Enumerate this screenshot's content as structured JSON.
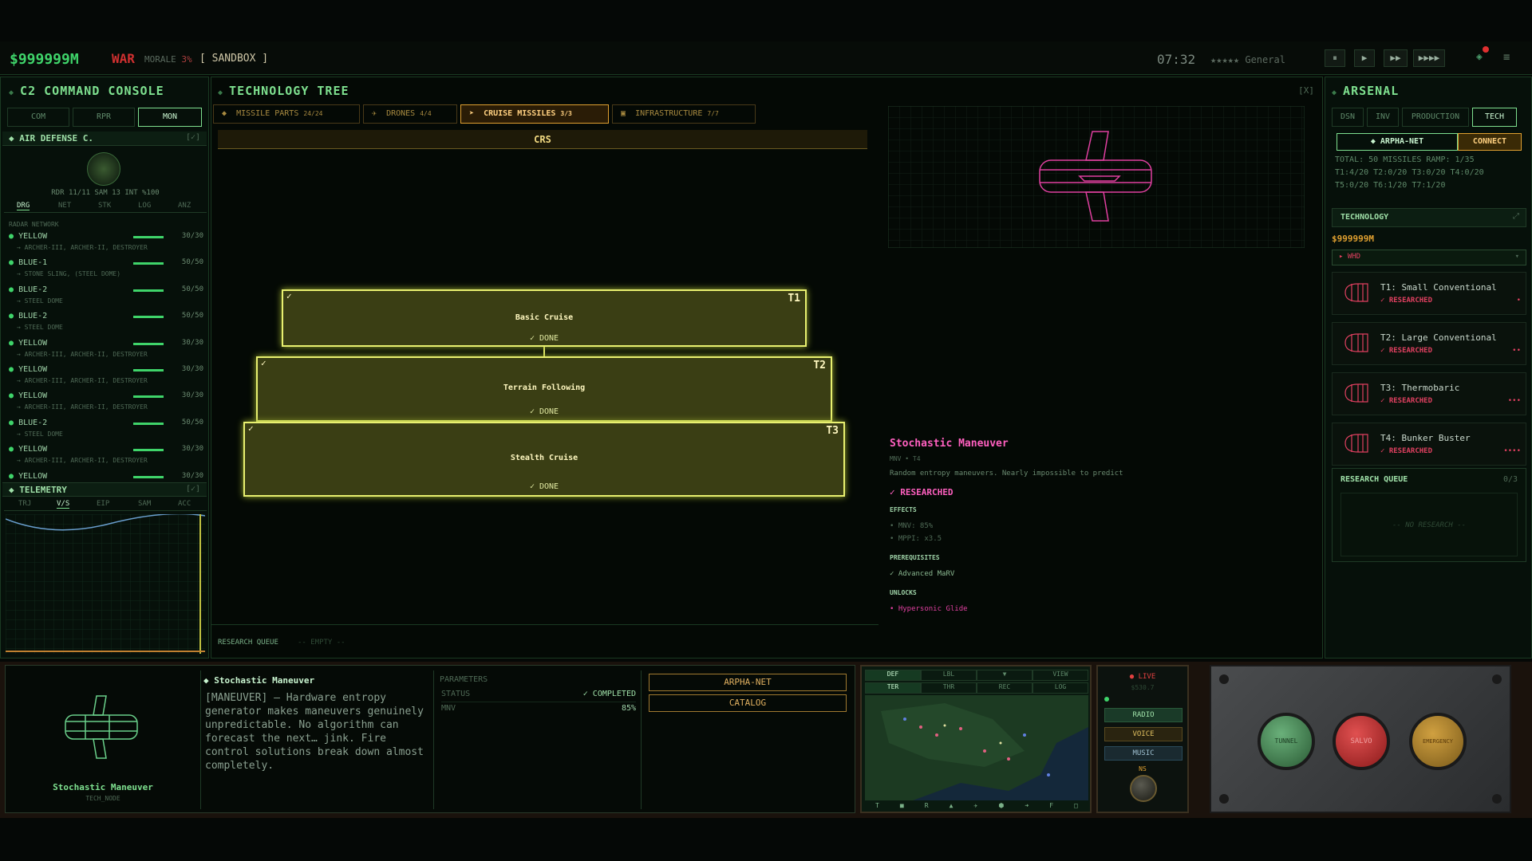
{
  "topbar": {
    "money": "$999999M",
    "war": "WAR",
    "morale_label": "MORALE",
    "morale_value": "3%",
    "mode": "[ SANDBOX ]",
    "clock": "07:32",
    "rank": "★★★★★ General",
    "speeds": [
      "⏸",
      "▶",
      "▶▶",
      "▶▶▶▶"
    ]
  },
  "left": {
    "title": "C2 COMMAND CONSOLE",
    "tabs": [
      "COM",
      "RPR",
      "MON"
    ],
    "section": "AIR DEFENSE C.",
    "section_toggle": "[✓]",
    "stats": "RDR 11/11  SAM 13  INT %100",
    "subtabs": [
      "DRG",
      "NET",
      "STK",
      "LOG",
      "ANZ"
    ],
    "radar_label": "RADAR NETWORK",
    "sites": [
      {
        "name": "YELLOW",
        "val": "30/30",
        "sub": "→ ARCHER-III, ARCHER-II, DESTROYER"
      },
      {
        "name": "BLUE-1",
        "val": "50/50",
        "sub": "→ STONE SLING, (STEEL DOME)"
      },
      {
        "name": "BLUE-2",
        "val": "50/50",
        "sub": "→ STEEL DOME"
      },
      {
        "name": "BLUE-2",
        "val": "50/50",
        "sub": "→ STEEL DOME"
      },
      {
        "name": "YELLOW",
        "val": "30/30",
        "sub": "→ ARCHER-III, ARCHER-II, DESTROYER"
      },
      {
        "name": "YELLOW",
        "val": "30/30",
        "sub": "→ ARCHER-III, ARCHER-II, DESTROYER"
      },
      {
        "name": "YELLOW",
        "val": "30/30",
        "sub": "→ ARCHER-III, ARCHER-II, DESTROYER"
      },
      {
        "name": "BLUE-2",
        "val": "50/50",
        "sub": "→ STEEL DOME"
      },
      {
        "name": "YELLOW",
        "val": "30/30",
        "sub": "→ ARCHER-III, ARCHER-II, DESTROYER"
      },
      {
        "name": "YELLOW",
        "val": "30/30",
        "sub": ""
      }
    ],
    "telemetry": "TELEMETRY",
    "tele_toggle": "[✓]",
    "tele_tabs": [
      "TRJ",
      "V/S",
      "EIP",
      "SAM",
      "ACC"
    ]
  },
  "center": {
    "title": "TECHNOLOGY TREE",
    "close": "[X]",
    "tabs": [
      {
        "icon": "◆",
        "label": "MISSILE PARTS",
        "count": "24/24"
      },
      {
        "icon": "✈",
        "label": "DRONES",
        "count": "4/4"
      },
      {
        "icon": "➤",
        "label": "CRUISE MISSILES",
        "count": "3/3"
      },
      {
        "icon": "▣",
        "label": "INFRASTRUCTURE",
        "count": "7/7"
      }
    ],
    "branch": "CRS",
    "nodes": [
      {
        "tier": "T1",
        "name": "Basic Cruise",
        "status": "✓ DONE"
      },
      {
        "tier": "T2",
        "name": "Terrain Following",
        "status": "✓ DONE"
      },
      {
        "tier": "T3",
        "name": "Stealth Cruise",
        "status": "✓ DONE"
      }
    ],
    "queue_label": "RESEARCH QUEUE",
    "queue_value": "-- EMPTY --",
    "detail": {
      "name": "Stochastic Maneuver",
      "meta": "MNV • T4",
      "desc": "Random entropy maneuvers. Nearly impossible to predict",
      "status": "✓ RESEARCHED",
      "effects_label": "EFFECTS",
      "effects": [
        "MNV: 85%",
        "MPPI: x3.5"
      ],
      "prereq_label": "PREREQUISITES",
      "prereq": "✓ Advanced MaRV",
      "unlocks_label": "UNLOCKS",
      "unlocks": "• Hypersonic Glide"
    }
  },
  "right": {
    "title": "ARSENAL",
    "tabs": [
      "DSN",
      "INV",
      "PRODUCTION",
      "TECH"
    ],
    "net": "◆ ARPHA-NET",
    "connect": "CONNECT",
    "total": "TOTAL: 50 MISSILES RAMP: 1/35",
    "tiers1": "T1:4/20  T2:0/20  T3:0/20  T4:0/20",
    "tiers2": "T5:0/20  T6:1/20  T7:1/20",
    "tech_title": "TECHNOLOGY",
    "tech_money": "$999999M",
    "dropdown": "▸ WHD",
    "cards": [
      {
        "name": "T1: Small Conventional",
        "status": "✓ RESEARCHED"
      },
      {
        "name": "T2: Large Conventional",
        "status": "✓ RESEARCHED"
      },
      {
        "name": "T3: Thermobaric",
        "status": "✓ RESEARCHED"
      },
      {
        "name": "T4: Bunker Buster",
        "status": "✓ RESEARCHED"
      }
    ],
    "rq_title": "RESEARCH QUEUE",
    "rq_count": "0/3",
    "rq_empty": "-- NO RESEARCH --"
  },
  "bottom": {
    "caption": "Stochastic Maneuver",
    "caption_sub": "TECH_NODE",
    "title": "◆ Stochastic Maneuver",
    "desc": "[MANEUVER] — Hardware entropy generator makes maneuvers genuinely unpredictable. No algorithm can forecast the next… jink. Fire control solutions break down almost completely.",
    "params_label": "PARAMETERS",
    "params": [
      {
        "k": "STATUS",
        "v": "✓ COMPLETED"
      },
      {
        "k": "MNV",
        "v": "85%"
      }
    ],
    "btn1": "ARPHA-NET",
    "btn2": "CATALOG",
    "map_tabs1": [
      "DEF",
      "LBL",
      "▼",
      "VIEW"
    ],
    "map_tabs2": [
      "TER",
      "THR",
      "REC",
      "LOG"
    ],
    "map_icons": [
      "T",
      "■",
      "R",
      "▲",
      "✈",
      "⬢",
      "➜",
      "F",
      "□"
    ],
    "live": "● LIVE",
    "live_sub": "$530.7",
    "radio": "RADIO",
    "voice": "VOICE",
    "music": "MUSIC",
    "knob": "NS",
    "buttons": [
      "TUNNEL",
      "SALVO",
      "EMERGENCY"
    ]
  },
  "colors": {
    "accent": "#7ee08f",
    "gold": "#e0a030",
    "magenta": "#ff60c0",
    "red": "#d03030"
  }
}
